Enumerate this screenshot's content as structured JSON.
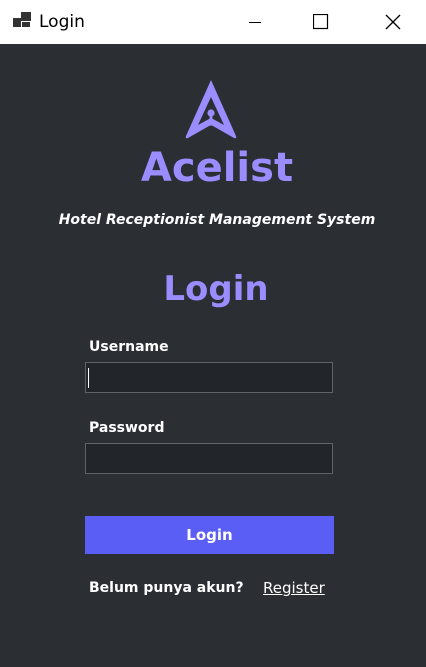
{
  "window": {
    "title": "Login",
    "controls": {
      "minimize_icon": "minimize-icon",
      "maximize_icon": "maximize-icon",
      "close_icon": "close-icon"
    }
  },
  "brand": {
    "logo_icon": "lock-arrow-logo-icon",
    "name": "Acelist",
    "tagline": "Hotel Receptionist Management System"
  },
  "form": {
    "heading": "Login",
    "username_label": "Username",
    "username_value": "",
    "password_label": "Password",
    "password_value": "",
    "submit_label": "Login"
  },
  "footer": {
    "prompt": "Belum punya akun?",
    "register_label": "Register"
  },
  "colors": {
    "background": "#2b2e33",
    "accent": "#9b8cff",
    "button": "#5b5ef4",
    "field_bg": "#22252a",
    "titlebar": "#ffffff"
  }
}
